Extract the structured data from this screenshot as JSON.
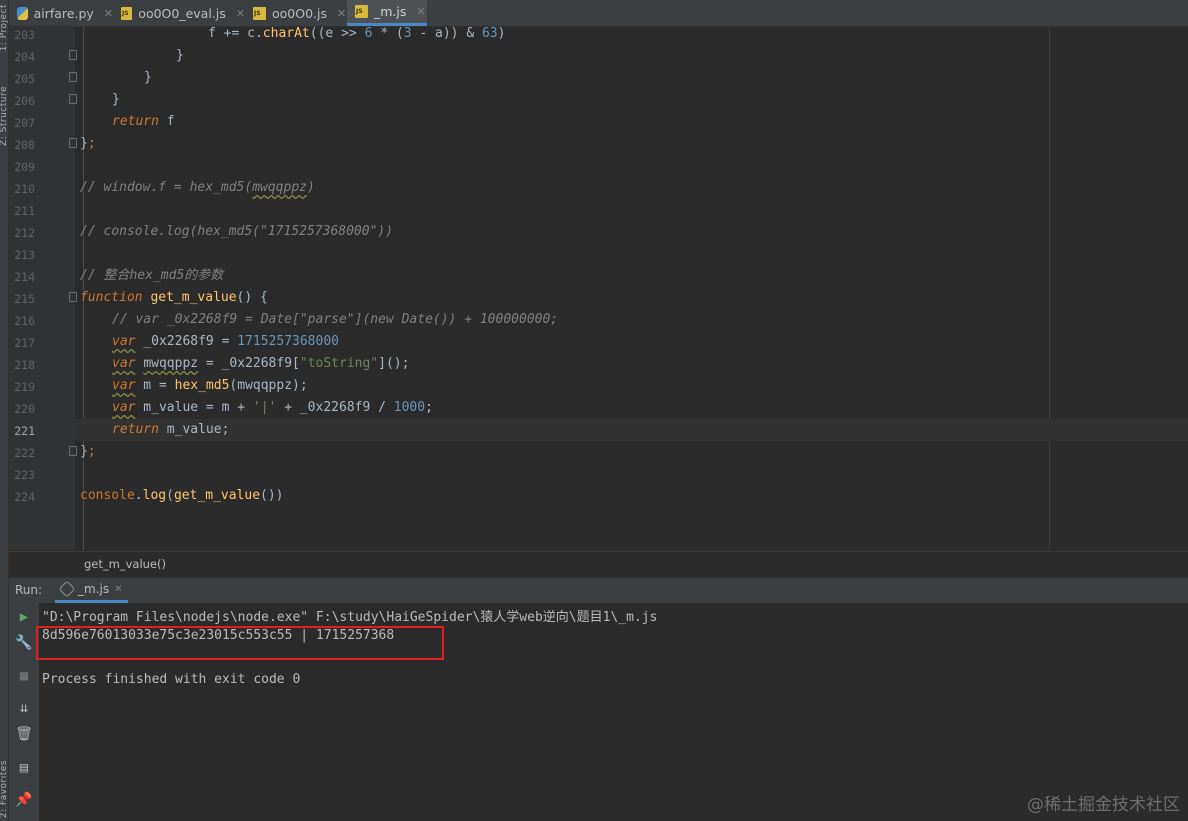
{
  "left_strip": {
    "project_label": "1: Project",
    "structure_label": "Z: Structure",
    "favorites_label": "2: Favorites"
  },
  "tabs": [
    {
      "name": "airfare.py",
      "icon": "python-file-icon",
      "active": false
    },
    {
      "name": "oo0O0_eval.js",
      "icon": "js-file-icon",
      "active": false
    },
    {
      "name": "oo0O0.js",
      "icon": "js-file-icon",
      "active": false
    },
    {
      "name": "_m.js",
      "icon": "js-file-icon",
      "active": true
    }
  ],
  "editor": {
    "line_numbers": [
      "203",
      "204",
      "205",
      "206",
      "207",
      "208",
      "209",
      "210",
      "211",
      "212",
      "213",
      "214",
      "215",
      "216",
      "217",
      "218",
      "219",
      "220",
      "221",
      "222",
      "223",
      "224"
    ],
    "current_line": "221",
    "code": {
      "l203": {
        "a": "f += c.",
        "b": "charAt",
        "c": "((e >> ",
        "d": "6",
        "e": " * (",
        "f": "3",
        "g": " - a)) & ",
        "h": "63",
        "i": ")"
      },
      "l204": "}",
      "l205": "}",
      "l206": "}",
      "l207": {
        "kw": "return",
        "rest": " f"
      },
      "l208": {
        "brace": "}",
        "semi": ";"
      },
      "l210": {
        "pre": "// window.f = hex_md5(",
        "wavy": "mwqqppz",
        "post": ")"
      },
      "l212": "// console.log(hex_md5(\"1715257368000\"))",
      "l214": "// 整合hex_md5的参数",
      "l215": {
        "kw": "function",
        "sp": " ",
        "fn": "get_m_value",
        "rest": "() {"
      },
      "l216": "// var _0x2268f9 = Date[\"parse\"](new Date()) + 100000000;",
      "l217": {
        "kw": "var",
        "rest": " _0x2268f9 = ",
        "num": "1715257368000"
      },
      "l218": {
        "kw": "var",
        "sp": " ",
        "wavy": "mwqqppz",
        "rest": " = _0x2268f9[",
        "str": "\"toString\"",
        "end": "]();"
      },
      "l219": {
        "kw": "var",
        "rest": " m = ",
        "fn": "hex_md5",
        "end": "(mwqqppz);"
      },
      "l220": {
        "kw": "var",
        "rest": " m_value = m + ",
        "str": "'|'",
        "mid": " + _0x2268f9 / ",
        "num": "1000",
        "end": ";"
      },
      "l221": {
        "kw": "return",
        "rest": " m_value;"
      },
      "l222": {
        "brace": "}",
        "semi": ";"
      },
      "l224": {
        "obj": "console",
        "dot": ".",
        "fn": "log",
        "open": "(",
        "fn2": "get_m_value",
        "close": "())"
      }
    }
  },
  "breadcrumb": "get_m_value()",
  "run_panel": {
    "label": "Run:",
    "tab_name": "_m.js",
    "console_lines": [
      "\"D:\\Program Files\\nodejs\\node.exe\" F:\\study\\HaiGeSpider\\猿人学web逆向\\题目1\\_m.js",
      "8d596e76013033e75c3e23015c553c55 | 1715257368",
      "",
      "Process finished with exit code 0"
    ],
    "tools": [
      "run-icon",
      "wrench-icon",
      "stop-icon",
      "scroll-to-end-icon",
      "trash-icon",
      "layout-icon",
      "pin-icon"
    ]
  },
  "watermark": "@稀土掘金技术社区",
  "colors": {
    "highlight_box": "#e02020",
    "accent": "#4a88c7"
  }
}
